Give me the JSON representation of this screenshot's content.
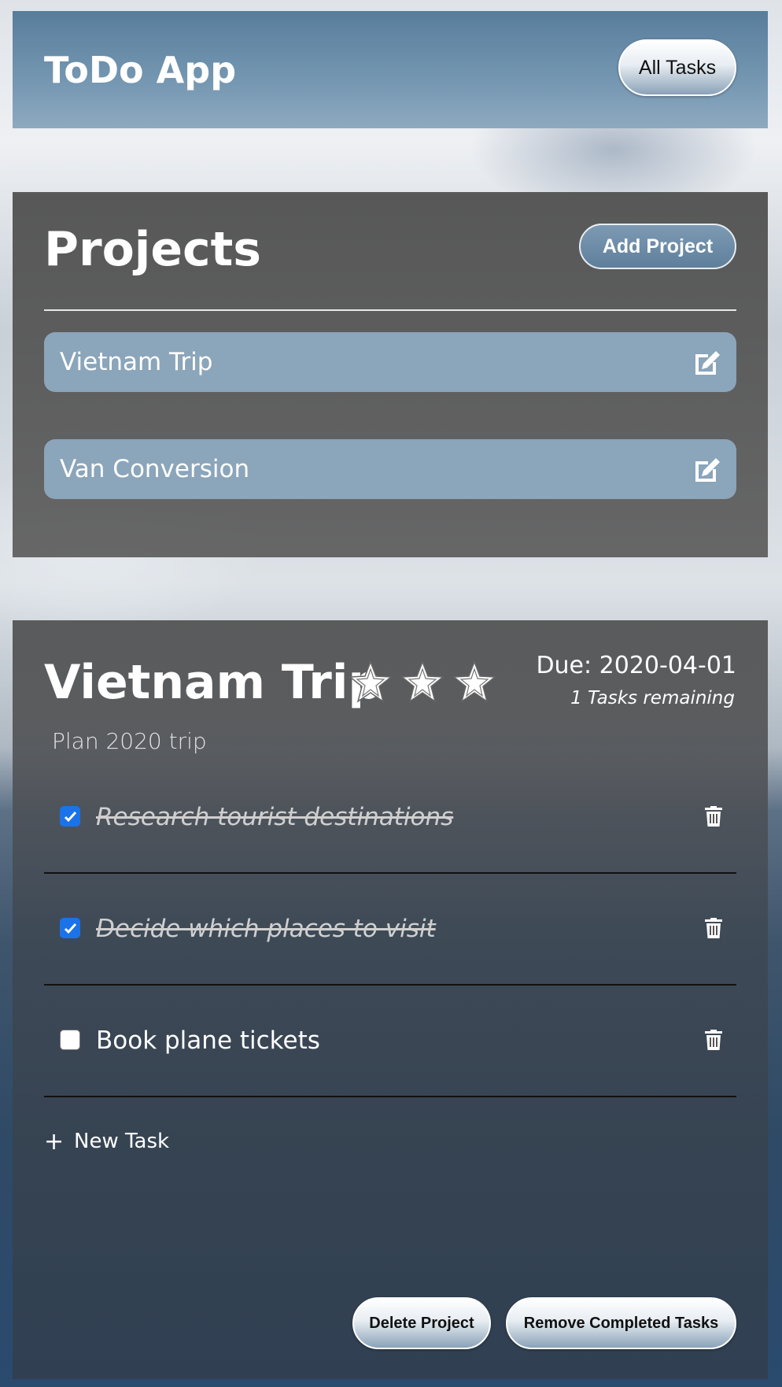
{
  "header": {
    "title": "ToDo App",
    "all_tasks_label": "All Tasks"
  },
  "projects": {
    "title": "Projects",
    "add_label": "Add Project",
    "items": [
      {
        "label": "Vietnam Trip",
        "icon": "edit-icon"
      },
      {
        "label": "Van Conversion",
        "icon": "edit-icon"
      }
    ]
  },
  "detail": {
    "title": "Vietnam Trip",
    "rating": 3,
    "rating_max": 3,
    "due": "Due: 2020-04-01",
    "remaining": "1 Tasks remaining",
    "description": "Plan 2020 trip",
    "tasks": [
      {
        "label": "Research tourist destinations",
        "completed": true
      },
      {
        "label": "Decide which places to visit",
        "completed": true
      },
      {
        "label": "Book plane tickets",
        "completed": false
      }
    ],
    "new_task_label": "New Task",
    "delete_label": "Delete Project",
    "remove_completed_label": "Remove Completed Tasks"
  },
  "colors": {
    "header_bg": "#6f91ad",
    "project_item_bg": "#8ba5ba",
    "checkbox_checked": "#1a73e8"
  }
}
